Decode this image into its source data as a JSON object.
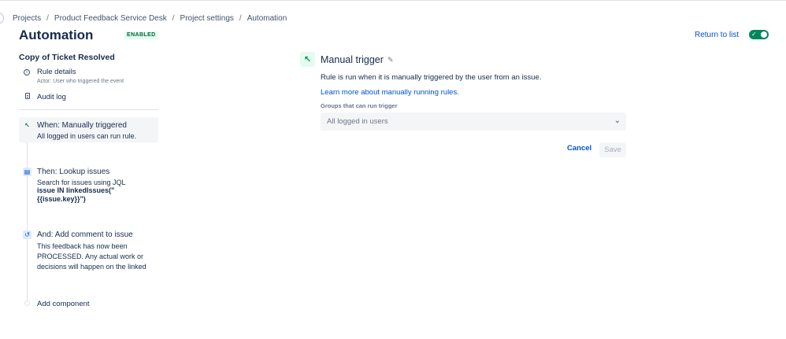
{
  "breadcrumb": {
    "items": [
      "Projects",
      "Product Feedback Service Desk",
      "Project settings",
      "Automation"
    ],
    "separator": "/"
  },
  "header": {
    "title": "Automation",
    "status": "ENABLED",
    "return_label": "Return to list",
    "toggle_on": true
  },
  "sidebar": {
    "rule_name": "Copy of Ticket Resolved",
    "details_title": "Rule details",
    "details_sub": "Actor: User who triggered the event",
    "audit_label": "Audit log",
    "steps": [
      {
        "title": "When: Manually triggered",
        "lines": [
          "All logged in users can run rule."
        ]
      },
      {
        "title": "Then: Lookup issues",
        "lines": [
          "Search for issues using JQL"
        ],
        "bold_lines": [
          "issue IN linkedIssues(\"",
          "{{issue.key}}\")"
        ]
      },
      {
        "title": "And: Add comment to issue",
        "lines": [
          "This feedback has now been",
          "PROCESSED. Any actual work or",
          "decisions will happen on the linked"
        ]
      }
    ],
    "add_label": "Add component"
  },
  "trigger": {
    "title": "Manual trigger",
    "description": "Rule is run when it is manually triggered by the user from an issue.",
    "learn_link": "Learn more about manually running rules.",
    "groups_label": "Groups that can run trigger",
    "groups_value": "All logged in users",
    "cancel_label": "Cancel",
    "save_label": "Save"
  },
  "colors": {
    "accent": "#0052CC",
    "success": "#00875A",
    "text": "#172B4D",
    "subtle": "#6B778C"
  }
}
